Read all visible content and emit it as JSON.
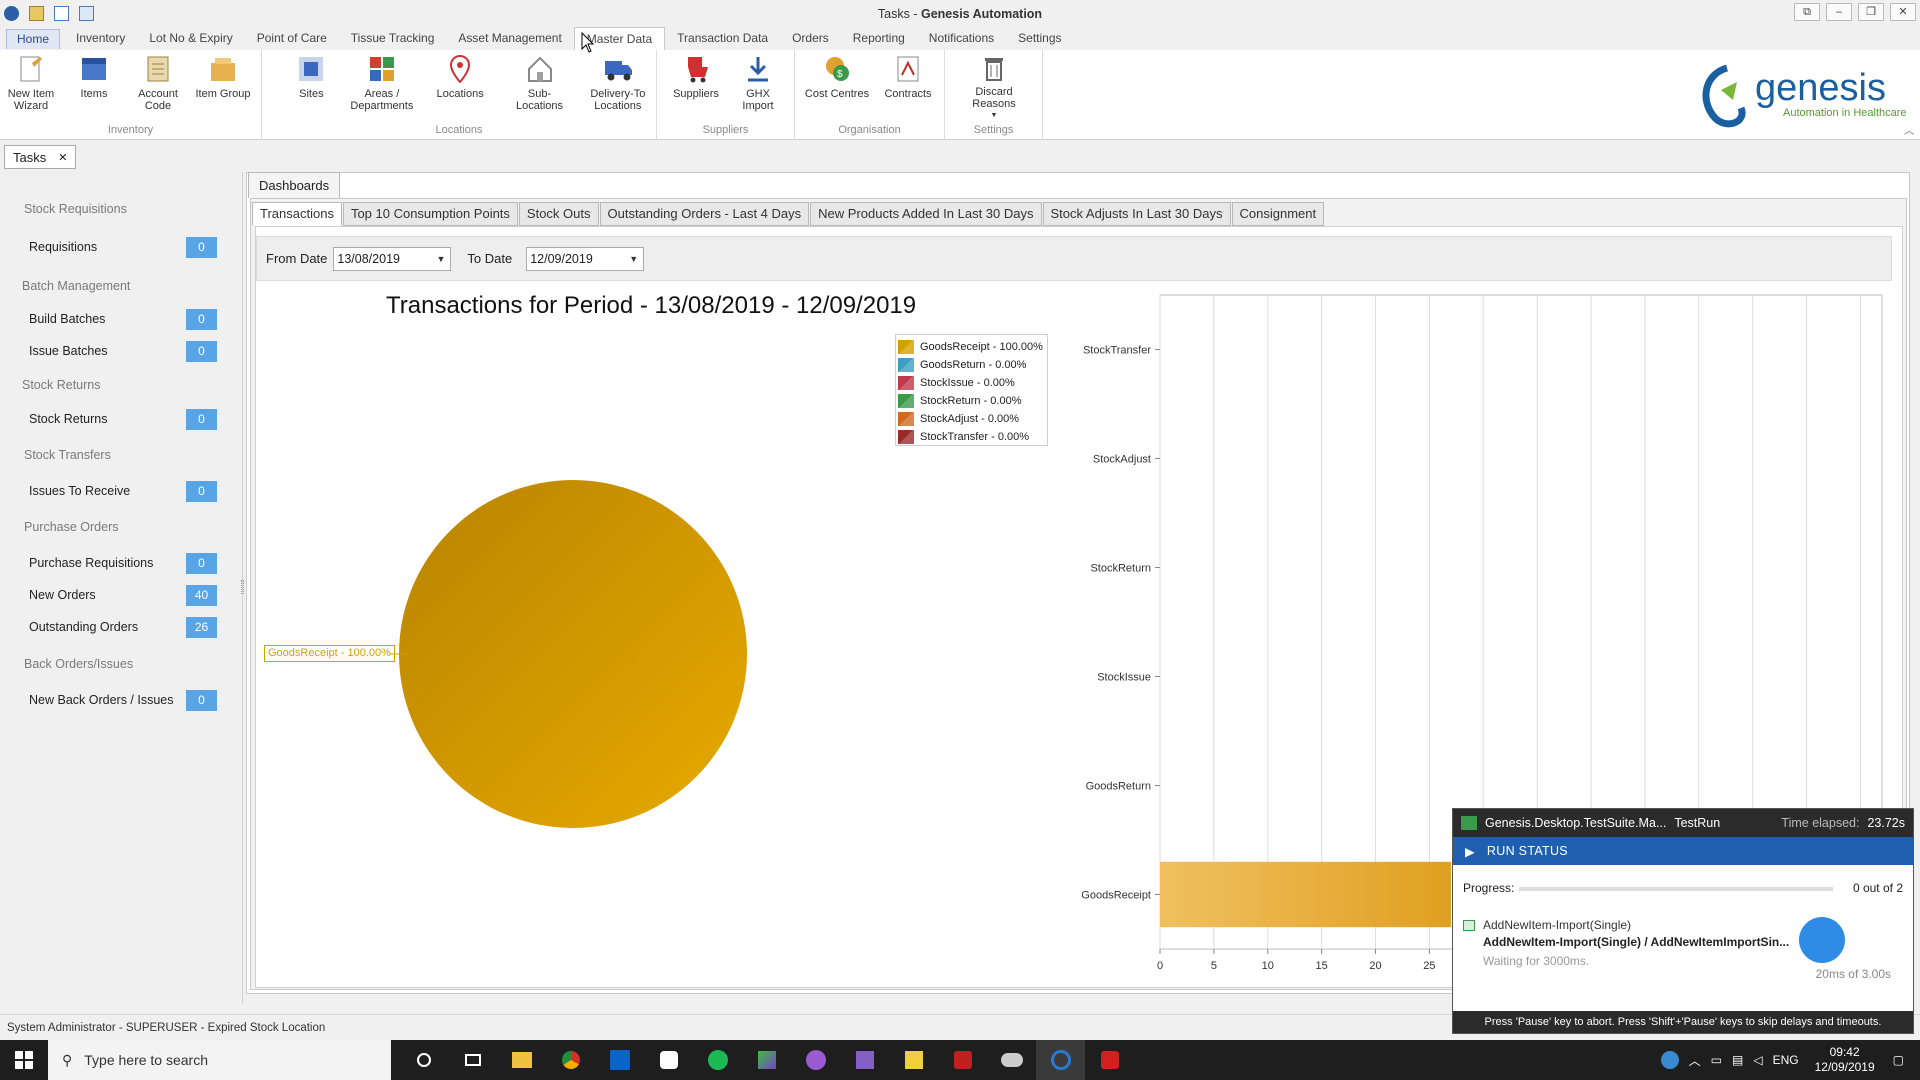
{
  "window": {
    "title_prefix": "Tasks - ",
    "title_app": "Genesis Automation"
  },
  "menu": [
    "Home",
    "Inventory",
    "Lot No & Expiry",
    "Point of Care",
    "Tissue Tracking",
    "Asset Management",
    "Master Data",
    "Transaction Data",
    "Orders",
    "Reporting",
    "Notifications",
    "Settings"
  ],
  "ribbon": {
    "inventory": {
      "label": "Inventory",
      "buttons": [
        "New Item\nWizard",
        "Items",
        "Account\nCode",
        "Item Group"
      ]
    },
    "locations": {
      "label": "Locations",
      "buttons": [
        "Sites",
        "Areas /\nDepartments",
        "Locations",
        "Sub-Locations",
        "Delivery-To\nLocations"
      ]
    },
    "suppliers": {
      "label": "Suppliers",
      "buttons": [
        "Suppliers",
        "GHX\nImport"
      ]
    },
    "organisation": {
      "label": "Organisation",
      "buttons": [
        "Cost Centres",
        "Contracts"
      ]
    },
    "settings": {
      "label": "Settings",
      "buttons": [
        "Discard Reasons"
      ]
    }
  },
  "logo": {
    "name": "genesis",
    "tagline": "Automation in Healthcare"
  },
  "doc_tab": {
    "label": "Tasks",
    "close": "✕"
  },
  "sidebar": {
    "stock_requisitions": "Stock Requisitions",
    "requisitions": "Requisitions",
    "requisitions_count": "0",
    "batch_management": "Batch Management",
    "build_batches": "Build Batches",
    "build_batches_count": "0",
    "issue_batches": "Issue Batches",
    "issue_batches_count": "0",
    "stock_returns_head": "Stock Returns",
    "stock_returns": "Stock Returns",
    "stock_returns_count": "0",
    "stock_transfers": "Stock Transfers",
    "issues_to_receive": "Issues To Receive",
    "issues_to_receive_count": "0",
    "purchase_orders": "Purchase Orders",
    "purchase_requisitions": "Purchase Requisitions",
    "purchase_requisitions_count": "0",
    "new_orders": "New Orders",
    "new_orders_count": "40",
    "outstanding_orders": "Outstanding Orders",
    "outstanding_orders_count": "26",
    "back_orders": "Back Orders/Issues",
    "new_back_orders": "New Back Orders / Issues",
    "new_back_orders_count": "0"
  },
  "dashboards": {
    "tab": "Dashboards",
    "subtabs": [
      "Transactions",
      "Top 10 Consumption Points",
      "Stock Outs",
      "Outstanding Orders - Last 4 Days",
      "New Products Added In Last 30 Days",
      "Stock Adjusts In Last 30 Days",
      "Consignment"
    ]
  },
  "filter": {
    "from_label": "From Date",
    "from_value": "13/08/2019",
    "to_label": "To Date",
    "to_value": "12/09/2019"
  },
  "chart_data": [
    {
      "type": "pie",
      "title": "Transactions for Period - 13/08/2019 - 12/09/2019",
      "categories": [
        "GoodsReceipt",
        "GoodsReturn",
        "StockIssue",
        "StockReturn",
        "StockAdjust",
        "StockTransfer"
      ],
      "values": [
        100,
        0,
        0,
        0,
        0,
        0
      ],
      "legend": [
        "GoodsReceipt - 100.00%",
        "GoodsReturn - 0.00%",
        "StockIssue - 0.00%",
        "StockReturn - 0.00%",
        "StockAdjust - 0.00%",
        "StockTransfer - 0.00%"
      ],
      "legend_colors": [
        "#d4a000",
        "#3a9fc0",
        "#c0394a",
        "#3a9a4a",
        "#d06a20",
        "#9a2a2a"
      ],
      "data_label": "GoodsReceipt - 100.00%",
      "legend_position": "top-right"
    },
    {
      "type": "bar",
      "orientation": "horizontal",
      "categories": [
        "StockTransfer",
        "StockAdjust",
        "StockReturn",
        "StockIssue",
        "GoodsReturn",
        "GoodsReceipt"
      ],
      "values": [
        0,
        0,
        0,
        0,
        0,
        27
      ],
      "x_ticks": [
        "0",
        "5",
        "10",
        "15",
        "20",
        "25"
      ],
      "xlim": [
        0,
        67
      ],
      "grid": true,
      "color": "#e8b040"
    }
  ],
  "status_bar": "System Administrator - SUPERUSER - Expired Stock Location",
  "run_panel": {
    "suite": "Genesis.Desktop.TestSuite.Ma...",
    "run": "TestRun",
    "elapsed_label": "Time elapsed:",
    "elapsed": "23.72s",
    "status": "RUN STATUS",
    "progress_label": "Progress:",
    "progress_value": "0 out of 2",
    "progress_fraction": 0,
    "step": "AddNewItem-Import(Single)",
    "step_path": "AddNewItem-Import(Single) / AddNewItemImportSin...",
    "waiting": "Waiting for 3000ms.",
    "timer": "20ms of 3.00s",
    "footer": "Press 'Pause' key to abort. Press 'Shift'+'Pause' keys to skip delays and timeouts."
  },
  "taskbar": {
    "search": "Type here to search",
    "lang": "ENG",
    "time": "09:42",
    "date": "12/09/2019"
  }
}
